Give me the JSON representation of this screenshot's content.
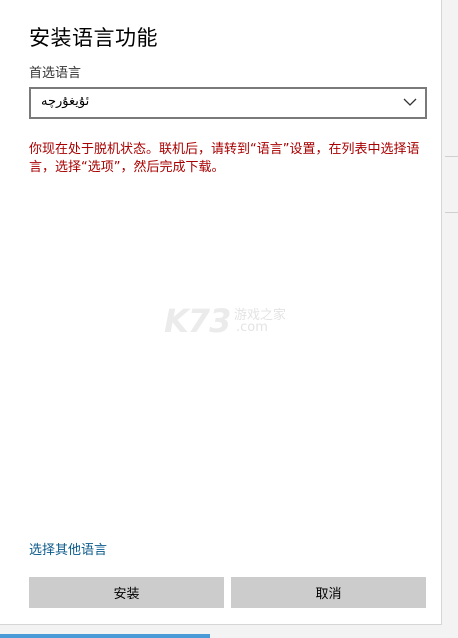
{
  "dialog": {
    "title": "安装语言功能",
    "preferred_language_label": "首选语言",
    "selected_language": "ئۇيغۇرچە",
    "offline_notice": "你现在处于脱机状态。联机后，请转到“语言”设置，在列表中选择语言，选择“选项”，然后完成下载。",
    "other_languages_link": "选择其他语言",
    "install_button": "安装",
    "cancel_button": "取消"
  },
  "watermark": {
    "brand": "K73",
    "tagline_top": "游戏之家",
    "tagline_bottom": ".com"
  },
  "icons": {
    "dropdown": "chevron-down-icon"
  },
  "colors": {
    "notice": "#a80000",
    "link": "#0b5a8a",
    "button_bg": "#cccccc",
    "accent": "#4b9ad8"
  }
}
